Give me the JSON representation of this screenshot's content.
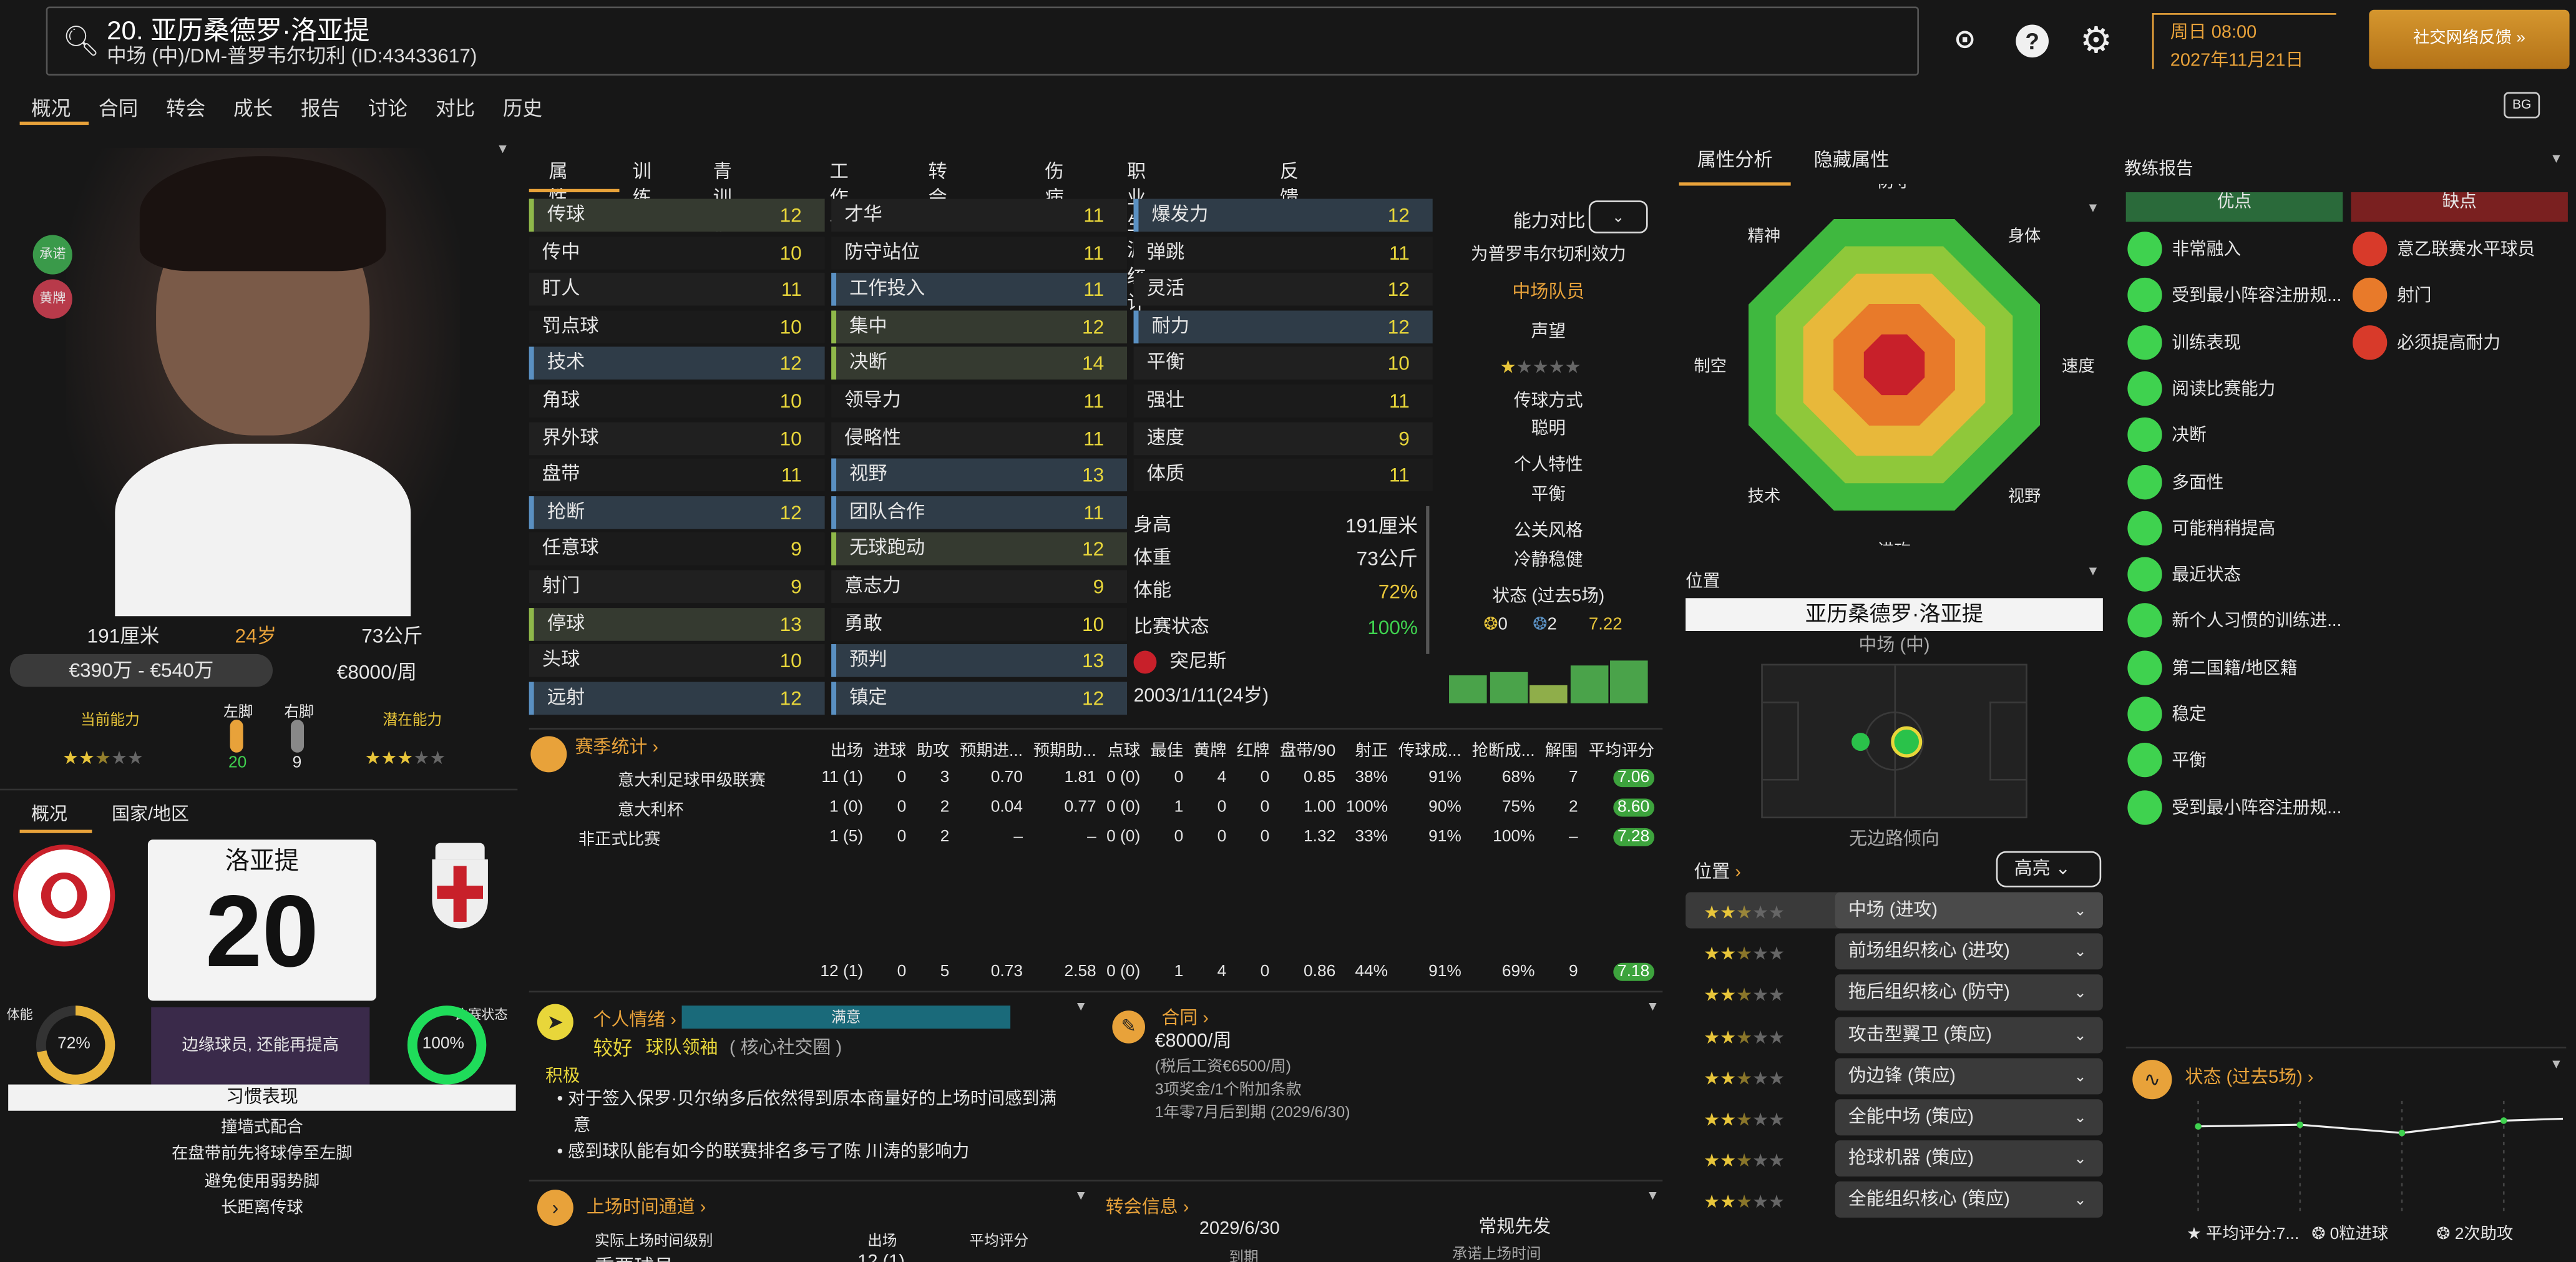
{
  "header": {
    "title": "20. 亚历桑德罗·洛亚提",
    "subtitle": "中场 (中)/DM-普罗韦尔切利 (ID:43433617)",
    "date_line1": "周日 08:00",
    "date_line2": "2027年11月21日",
    "social_button": "社交网络反馈"
  },
  "menu": [
    "概况",
    "合同",
    "转会",
    "成长",
    "报告",
    "讨论",
    "对比",
    "历史"
  ],
  "profile": {
    "height": "191厘米",
    "age": "24岁",
    "weight": "73公斤",
    "value": "€390万 - €540万",
    "wage": "€8000/周",
    "current_ability_label": "当前能力",
    "left_foot_label": "左脚",
    "right_foot_label": "右脚",
    "left_foot_value": "20",
    "right_foot_value": "9",
    "potential_label": "潜在能力",
    "badge1": "承诺",
    "badge2": "黄牌",
    "tab1": "概况",
    "tab2": "国家/地区",
    "shirt_name": "洛亚提",
    "shirt_number": "20",
    "fitness_label": "体能",
    "fitness_value": "72%",
    "form_label": "比赛状态",
    "form_value": "100%",
    "role_note": "边缘球员, 还能再提高",
    "habits_title": "习惯表现",
    "habits": [
      "撞墙式配合",
      "在盘带前先将球停至左脚",
      "避免使用弱势脚",
      "长距离传球"
    ]
  },
  "tabs": [
    "属性",
    "训练",
    "青训信息",
    "工作证",
    "转会状态",
    "伤病",
    "职业生涯统计",
    "反馈"
  ],
  "attributes": {
    "technical": [
      [
        "传球",
        "12"
      ],
      [
        "传中",
        "10"
      ],
      [
        "盯人",
        "11"
      ],
      [
        "罚点球",
        "10"
      ],
      [
        "技术",
        "12"
      ],
      [
        "角球",
        "10"
      ],
      [
        "界外球",
        "10"
      ],
      [
        "盘带",
        "11"
      ],
      [
        "抢断",
        "12"
      ],
      [
        "任意球",
        "9"
      ],
      [
        "射门",
        "9"
      ],
      [
        "停球",
        "13"
      ],
      [
        "头球",
        "10"
      ],
      [
        "远射",
        "12"
      ]
    ],
    "mental": [
      [
        "才华",
        "11"
      ],
      [
        "防守站位",
        "11"
      ],
      [
        "工作投入",
        "11"
      ],
      [
        "集中",
        "12"
      ],
      [
        "决断",
        "14"
      ],
      [
        "领导力",
        "11"
      ],
      [
        "侵略性",
        "11"
      ],
      [
        "视野",
        "13"
      ],
      [
        "团队合作",
        "11"
      ],
      [
        "无球跑动",
        "12"
      ],
      [
        "意志力",
        "9"
      ],
      [
        "勇敢",
        "10"
      ],
      [
        "预判",
        "13"
      ],
      [
        "镇定",
        "12"
      ]
    ],
    "physical": [
      [
        "爆发力",
        "12"
      ],
      [
        "弹跳",
        "11"
      ],
      [
        "灵活",
        "12"
      ],
      [
        "耐力",
        "12"
      ],
      [
        "平衡",
        "10"
      ],
      [
        "强壮",
        "11"
      ],
      [
        "速度",
        "9"
      ],
      [
        "体质",
        "11"
      ]
    ]
  },
  "bio": [
    [
      "身高",
      "191厘米"
    ],
    [
      "体重",
      "73公斤"
    ],
    [
      "体能",
      "72%"
    ],
    [
      "比赛状态",
      "100%"
    ]
  ],
  "nationality": "突尼斯",
  "birth": "2003/1/11(24岁)",
  "compare": {
    "label": "能力对比",
    "efficiency_label": "为普罗韦尔切利效力",
    "efficiency_value": "中场队员",
    "reputation_label": "声望",
    "pass_style_label": "传球方式",
    "pass_style": "聪明",
    "personality_label": "个人特性",
    "personality": "平衡",
    "media_label": "公关风格",
    "media": "冷静稳健",
    "form5_label": "状态 (过去5场)",
    "goals": "0",
    "assists": "2",
    "avg": "7.22"
  },
  "season_stats": {
    "title": "赛季统计",
    "columns": [
      "出场",
      "进球",
      "助攻",
      "预期进...",
      "预期助...",
      "点球",
      "最佳",
      "黄牌",
      "红牌",
      "盘带/90",
      "射正",
      "传球成...",
      "抢断成...",
      "解围",
      "平均评分"
    ],
    "rows": [
      [
        "意大利足球甲级联赛",
        "11 (1)",
        "0",
        "3",
        "0.70",
        "1.81",
        "0 (0)",
        "0",
        "4",
        "0",
        "0.85",
        "38%",
        "91%",
        "68%",
        "7",
        "7.06"
      ],
      [
        "意大利杯",
        "1 (0)",
        "0",
        "2",
        "0.04",
        "0.77",
        "0 (0)",
        "1",
        "0",
        "0",
        "1.00",
        "100%",
        "90%",
        "75%",
        "2",
        "8.60"
      ],
      [
        "非正式比赛",
        "1 (5)",
        "0",
        "2",
        "–",
        "–",
        "0 (0)",
        "0",
        "0",
        "0",
        "1.32",
        "33%",
        "91%",
        "100%",
        "–",
        "7.28"
      ]
    ],
    "total": [
      "12 (1)",
      "0",
      "5",
      "0.73",
      "2.58",
      "0 (0)",
      "1",
      "4",
      "0",
      "0.86",
      "44%",
      "91%",
      "69%",
      "9",
      "7.18"
    ]
  },
  "mood": {
    "title": "个人情绪",
    "bar": "满意",
    "level": "较好",
    "role": "球队领袖",
    "group": "( 核心社交圈 )",
    "positive": "积极",
    "items": [
      "对于签入保罗·贝尔纳多后依然得到原本商量好的上场时间感到满意",
      "感到球队能有如今的联赛排名多亏了陈 川涛的影响力"
    ]
  },
  "contract": {
    "title": "合同",
    "wage": "€8000/周",
    "net": "(税后工资€6500/周)",
    "bonus": "3项奖金/1个附加条款",
    "expiry": "1年零7月后到期 (2029/6/30)"
  },
  "playtime": {
    "title": "上场时间通道",
    "c1": "实际上场时间级别",
    "c2": "出场",
    "c3": "平均评分",
    "r1": "重要球员",
    "r2": "12 (1)"
  },
  "transfer": {
    "title": "转会信息",
    "date": "2029/6/30",
    "expiry": "到期",
    "status": "常规先发",
    "promise": "承诺上场时间"
  },
  "right_tabs": [
    "属性分析",
    "隐藏属性"
  ],
  "radar": [
    "防守",
    "身体",
    "速度",
    "视野",
    "进攻",
    "技术",
    "制空",
    "精神"
  ],
  "position": {
    "label": "位置",
    "name": "亚历桑德罗·洛亚提",
    "role": "中场 (中)",
    "tendency": "无边路倾向",
    "sub_label": "位置",
    "highlight": "高亮"
  },
  "roles": [
    [
      "中场 (进攻)",
      2.5
    ],
    [
      "前场组织核心 (进攻)",
      2.5
    ],
    [
      "拖后组织核心 (防守)",
      2.5
    ],
    [
      "攻击型翼卫 (策应)",
      2.5
    ],
    [
      "伪边锋 (策应)",
      2.5
    ],
    [
      "全能中场 (策应)",
      2.5
    ],
    [
      "抢球机器 (策应)",
      2.5
    ],
    [
      "全能组织核心 (策应)",
      2.5
    ]
  ],
  "coach": {
    "title": "教练报告",
    "pros": "优点",
    "cons": "缺点",
    "pros_items": [
      "非常融入",
      "受到最小阵容注册规...",
      "训练表现",
      "阅读比赛能力",
      "决断",
      "多面性",
      "可能稍稍提高",
      "最近状态",
      "新个人习惯的训练进...",
      "第二国籍/地区籍",
      "稳定",
      "平衡",
      "受到最小阵容注册规..."
    ],
    "cons_items": [
      "意乙联赛水平球员",
      "射门",
      "必须提高耐力"
    ]
  },
  "form_panel": {
    "title": "状态 (过去5场)",
    "avg": "平均评分:7...",
    "goals": "0粒进球",
    "assists": "2次助攻",
    "values": [
      7.06,
      7.1,
      6.9,
      7.2,
      7.28
    ]
  },
  "colors": {
    "accent": "#e8a23a",
    "green": "#3fd24f",
    "blue": "#5a90c2"
  }
}
